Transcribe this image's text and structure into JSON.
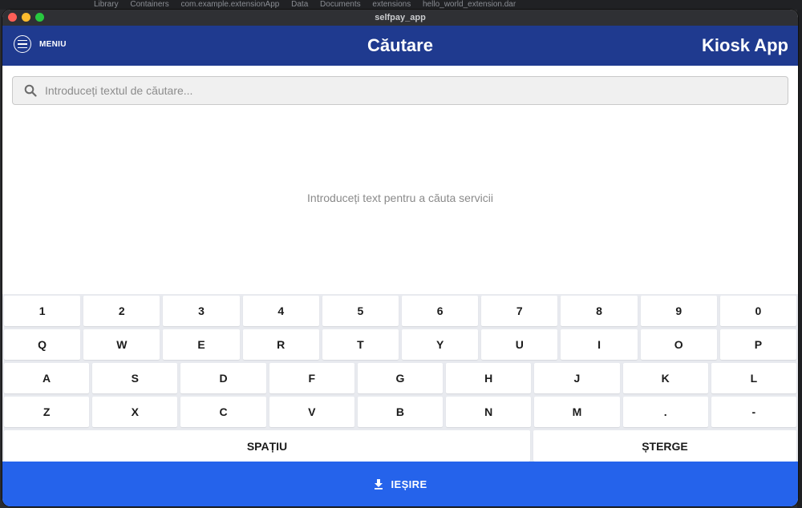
{
  "background": {
    "breadcrumb": [
      "Library",
      "Containers",
      "com.example.extensionApp",
      "Data",
      "Documents",
      "extensions",
      "hello_world_extension.dar"
    ]
  },
  "window": {
    "title": "selfpay_app"
  },
  "appbar": {
    "menu_label": "MENIU",
    "title": "Căutare",
    "brand": "Kiosk App",
    "color": "#1f3a8f"
  },
  "search": {
    "placeholder": "Introduceți textul de căutare...",
    "value": ""
  },
  "results": {
    "empty_message": "Introduceți text pentru a căuta servicii"
  },
  "keyboard": {
    "rows": [
      [
        "1",
        "2",
        "3",
        "4",
        "5",
        "6",
        "7",
        "8",
        "9",
        "0"
      ],
      [
        "Q",
        "W",
        "E",
        "R",
        "T",
        "Y",
        "U",
        "I",
        "O",
        "P"
      ],
      [
        "A",
        "S",
        "D",
        "F",
        "G",
        "H",
        "J",
        "K",
        "L"
      ],
      [
        "Z",
        "X",
        "C",
        "V",
        "B",
        "N",
        "M",
        ".",
        "-"
      ]
    ],
    "space_label": "SPAȚIU",
    "delete_label": "ȘTERGE"
  },
  "exit": {
    "label": "IEȘIRE",
    "icon": "download-icon",
    "color": "#2563eb"
  }
}
